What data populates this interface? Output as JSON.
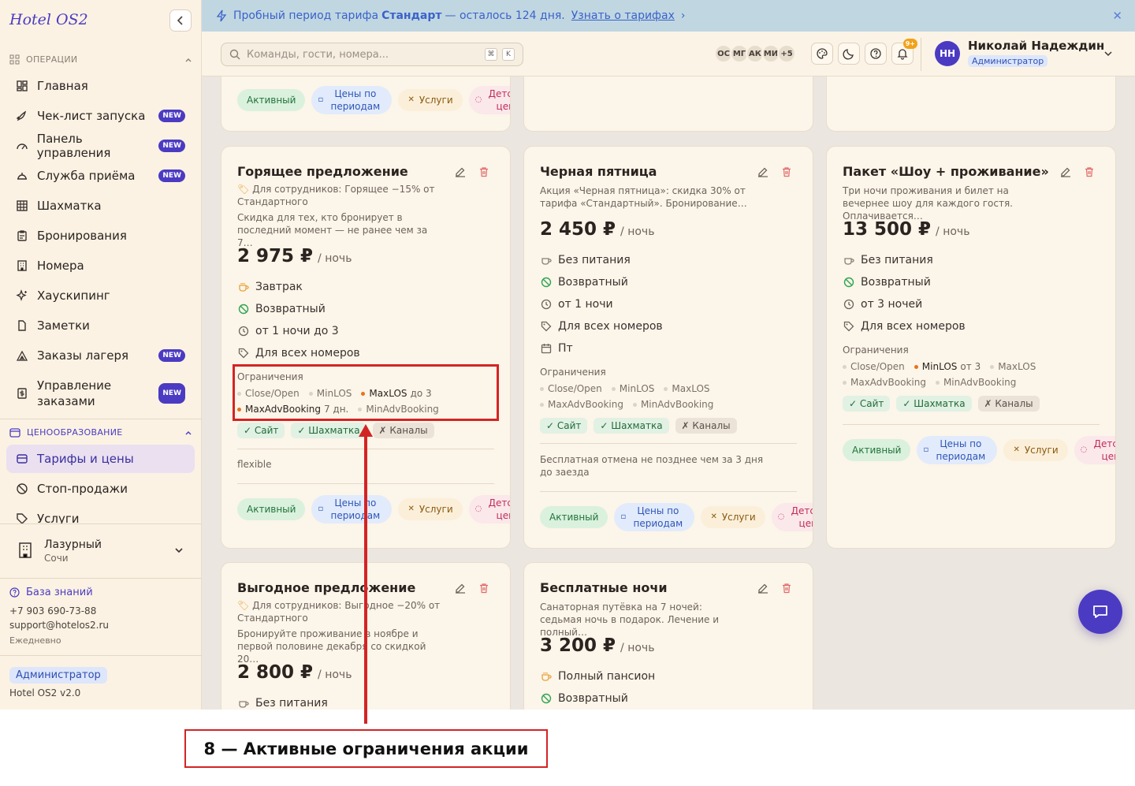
{
  "app": {
    "logo": "Hotel OS2"
  },
  "sidebar": {
    "sections": {
      "ops": "ОПЕРАЦИИ",
      "pricing": "ЦЕНООБРАЗОВАНИЕ"
    },
    "items": [
      {
        "label": "Главная"
      },
      {
        "label": "Чек-лист запуска",
        "badge": "NEW"
      },
      {
        "label": "Панель управления",
        "badge": "NEW"
      },
      {
        "label": "Служба приёма",
        "badge": "NEW"
      },
      {
        "label": "Шахматка"
      },
      {
        "label": "Бронирования"
      },
      {
        "label": "Номера"
      },
      {
        "label": "Хаускипинг"
      },
      {
        "label": "Заметки"
      },
      {
        "label": "Заказы лагеря",
        "badge": "NEW"
      },
      {
        "label": "Управление заказами",
        "badge": "NEW"
      },
      {
        "label": "Тарифы и цены"
      },
      {
        "label": "Стоп-продажи"
      },
      {
        "label": "Услуги"
      }
    ],
    "hotel": {
      "name": "Лазурный",
      "city": "Сочи"
    },
    "knowledge": "База знаний",
    "phone": "+7 903 690-73-88",
    "email": "support@hotelos2.ru",
    "schedule": "Ежедневно",
    "role": "Администратор",
    "version": "Hotel OS2 v2.0"
  },
  "banner": {
    "prefix": "Пробный период тарифа",
    "plan": "Стандарт",
    "suffix": "— осталось 124 дня.",
    "link": "Узнать о тарифах"
  },
  "topbar": {
    "search_placeholder": "Команды, гости, номера...",
    "kbd1": "⌘",
    "kbd2": "K",
    "avatars": [
      "ОС",
      "МГ",
      "АК",
      "МИ",
      "+5"
    ],
    "notif_count": "9+",
    "user": {
      "initials": "НН",
      "name": "Николай Надеждин",
      "role": "Администратор"
    }
  },
  "labels": {
    "restrictions": "Ограничения",
    "site": "✓ Сайт",
    "chess": "✓ Шахматка",
    "channels": "✗ Каналы",
    "active": "Активный",
    "periods": "Цены по периодам",
    "services": "Услуги",
    "kids": "Детские цены",
    "per_night": "/ ночь"
  },
  "cards": [
    {
      "title": "Горящее предложение",
      "staff": "Для сотрудников: Горящее −15% от Стандартного",
      "desc": "Скидка для тех, кто бронирует в последний момент — не ранее чем за 7…",
      "price": "2 975 ₽",
      "meal": "Завтрак",
      "refund": "Возвратный",
      "nights": "от 1 ночи до 3",
      "rooms": "Для всех номеров",
      "r": [
        {
          "n": "Close/Open"
        },
        {
          "n": "MinLOS"
        },
        {
          "n": "MaxLOS",
          "e": "до 3"
        },
        {
          "n": "MaxAdvBooking",
          "e": "7 дн."
        },
        {
          "n": "MinAdvBooking"
        }
      ],
      "note": "flexible"
    },
    {
      "title": "Черная пятница",
      "desc": "Акция «Черная пятница»: скидка 30% от тарифа «Стандартный». Бронирование…",
      "price": "2 450 ₽",
      "meal": "Без питания",
      "refund": "Возвратный",
      "nights": "от 1 ночи",
      "rooms": "Для всех номеров",
      "days": "Пт",
      "r": [
        {
          "n": "Close/Open"
        },
        {
          "n": "MinLOS"
        },
        {
          "n": "MaxLOS"
        },
        {
          "n": "MaxAdvBooking"
        },
        {
          "n": "MinAdvBooking"
        }
      ],
      "note": "Бесплатная отмена не позднее чем за 3 дня до заезда"
    },
    {
      "title": "Пакет «Шоу + проживание»",
      "desc": "Три ночи проживания и билет на вечернее шоу для каждого гостя. Оплачивается…",
      "price": "13 500 ₽",
      "meal": "Без питания",
      "refund": "Возвратный",
      "nights": "от 3 ночей",
      "rooms": "Для всех номеров",
      "r": [
        {
          "n": "Close/Open"
        },
        {
          "n": "MinLOS",
          "e": "от 3"
        },
        {
          "n": "MaxLOS"
        },
        {
          "n": "MaxAdvBooking"
        },
        {
          "n": "MinAdvBooking"
        }
      ]
    },
    {
      "title": "Выгодное предложение",
      "staff": "Для сотрудников: Выгодное −20% от Стандартного",
      "desc": "Бронируйте проживание в ноябре и первой половине декабря со скидкой 20…",
      "price": "2 800 ₽",
      "meal": "Без питания"
    },
    {
      "title": "Бесплатные ночи",
      "desc": "Санаторная путёвка на 7 ночей: седьмая ночь в подарок. Лечение и полный…",
      "price": "3 200 ₽",
      "meal": "Полный пансион",
      "refund": "Возвратный"
    }
  ],
  "annotation": {
    "caption": "8 — Активные ограничения акции"
  }
}
